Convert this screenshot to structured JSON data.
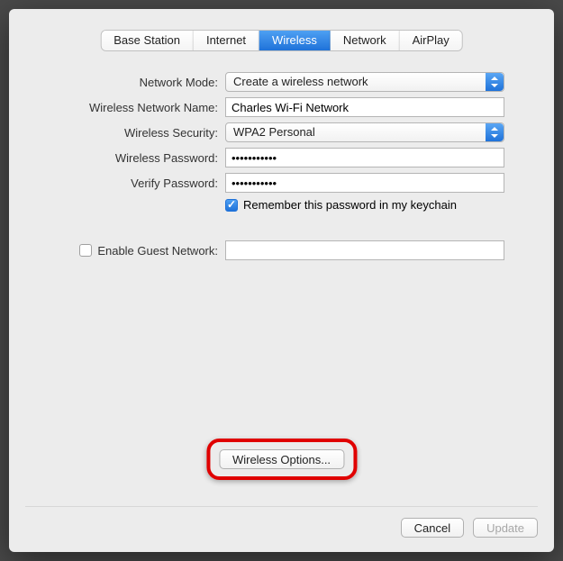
{
  "tabs": {
    "base_station": "Base Station",
    "internet": "Internet",
    "wireless": "Wireless",
    "network": "Network",
    "airplay": "AirPlay"
  },
  "labels": {
    "network_mode": "Network Mode:",
    "network_name": "Wireless Network Name:",
    "security": "Wireless Security:",
    "password": "Wireless Password:",
    "verify": "Verify Password:",
    "remember": "Remember this password in my keychain",
    "guest": "Enable Guest Network:"
  },
  "values": {
    "network_mode": "Create a wireless network",
    "network_name": "Charles Wi-Fi Network",
    "security": "WPA2 Personal",
    "password": "•••••••••••",
    "verify": "•••••••••••",
    "guest": ""
  },
  "checkboxes": {
    "remember_checked": true,
    "guest_checked": false
  },
  "buttons": {
    "wireless_options": "Wireless Options...",
    "cancel": "Cancel",
    "update": "Update"
  }
}
